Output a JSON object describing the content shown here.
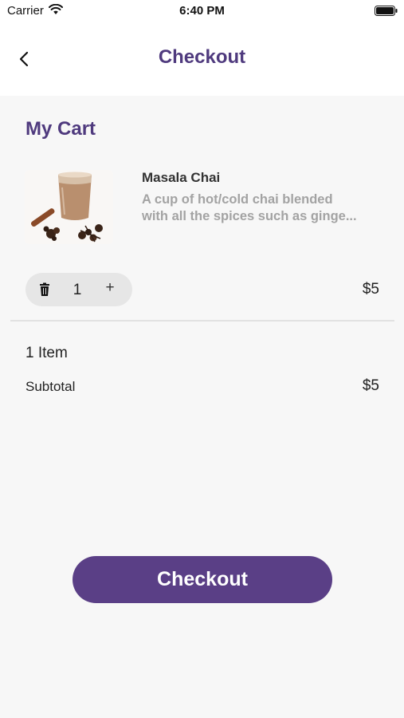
{
  "status_bar": {
    "carrier": "Carrier",
    "time": "6:40 PM"
  },
  "nav": {
    "title": "Checkout",
    "back_icon": "chevron-left-icon"
  },
  "cart": {
    "heading": "My Cart",
    "items": [
      {
        "name": "Masala Chai",
        "description_line1": "A cup of hot/cold chai blended",
        "description_line2": "with all the spices such as ginge...",
        "quantity": "1",
        "price": "$5",
        "remove_icon": "trash-icon",
        "increment_label": "+"
      }
    ]
  },
  "summary": {
    "item_count": "1 Item",
    "subtotal_label": "Subtotal",
    "subtotal_value": "$5"
  },
  "checkout_button": {
    "label": "Checkout"
  },
  "colors": {
    "accent": "#4f3a7e",
    "button": "#5a3f86",
    "background": "#f7f7f7",
    "muted_text": "#a3a3a3"
  }
}
